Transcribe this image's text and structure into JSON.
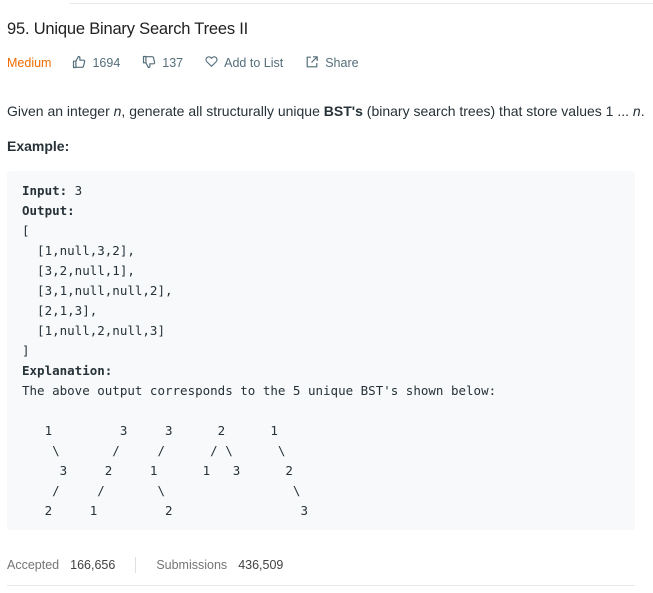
{
  "problem": {
    "title": "95. Unique Binary Search Trees II",
    "difficulty": "Medium",
    "likes": "1694",
    "dislikes": "137",
    "add_to_list": "Add to List",
    "share": "Share",
    "colors": {
      "difficulty": "#ef6c00",
      "code_bg": "#f7f9fa"
    }
  },
  "description": {
    "before_n": "Given an integer ",
    "n": "n",
    "mid": ", generate all structurally unique ",
    "bst": "BST's",
    "after": " (binary search trees) that store values 1 ... ",
    "n2": "n",
    "period": "."
  },
  "example_label": "Example:",
  "code": {
    "input_label": "Input:",
    "input_value": " 3",
    "output_label": "Output:",
    "lines": [
      "[",
      "  [1,null,3,2],",
      "  [3,2,null,1],",
      "  [3,1,null,null,2],",
      "  [2,1,3],",
      "  [1,null,2,null,3]",
      "]"
    ],
    "explanation_label": "Explanation:",
    "explanation": "The above output corresponds to the 5 unique BST's shown below:",
    "diagram": [
      "   1         3     3      2      1",
      "    \\       /     /      / \\      \\",
      "     3     2     1      1   3      2",
      "    /     /       \\                 \\",
      "   2     1         2                 3"
    ]
  },
  "stats": {
    "accepted_label": "Accepted",
    "accepted_value": "166,656",
    "submissions_label": "Submissions",
    "submissions_value": "436,509"
  },
  "icons": {
    "like": "thumbs-up-icon",
    "dislike": "thumbs-down-icon",
    "add": "heart-icon",
    "share": "share-icon"
  }
}
